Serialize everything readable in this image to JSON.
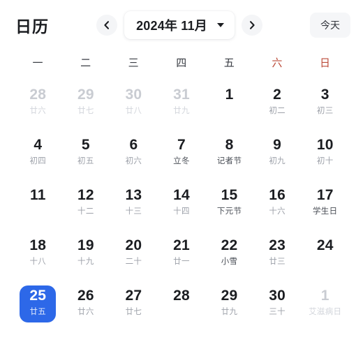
{
  "header": {
    "app_title": "日历",
    "prev_icon": "chevron-left-icon",
    "next_icon": "chevron-right-icon",
    "month_label": "2024年 11月",
    "dropdown_icon": "caret-down-icon",
    "today_label": "今天"
  },
  "colors": {
    "accent": "#2d68e8",
    "weekend": "#bb4a38",
    "text": "#1b1d21",
    "muted": "#9ea2aa",
    "outside": "#c9ccd2",
    "chip_bg": "#f4f5f7"
  },
  "weekdays": [
    {
      "label": "一",
      "weekend": false
    },
    {
      "label": "二",
      "weekend": false
    },
    {
      "label": "三",
      "weekend": false
    },
    {
      "label": "四",
      "weekend": false
    },
    {
      "label": "五",
      "weekend": false
    },
    {
      "label": "六",
      "weekend": true
    },
    {
      "label": "日",
      "weekend": true
    }
  ],
  "days": [
    {
      "day": "28",
      "lunar": "廿六",
      "outside": true,
      "festival": false,
      "selected": false
    },
    {
      "day": "29",
      "lunar": "廿七",
      "outside": true,
      "festival": false,
      "selected": false
    },
    {
      "day": "30",
      "lunar": "廿八",
      "outside": true,
      "festival": false,
      "selected": false
    },
    {
      "day": "31",
      "lunar": "廿九",
      "outside": true,
      "festival": false,
      "selected": false
    },
    {
      "day": "1",
      "lunar": "",
      "outside": false,
      "festival": false,
      "selected": false
    },
    {
      "day": "2",
      "lunar": "初二",
      "outside": false,
      "festival": false,
      "selected": false
    },
    {
      "day": "3",
      "lunar": "初三",
      "outside": false,
      "festival": false,
      "selected": false
    },
    {
      "day": "4",
      "lunar": "初四",
      "outside": false,
      "festival": false,
      "selected": false
    },
    {
      "day": "5",
      "lunar": "初五",
      "outside": false,
      "festival": false,
      "selected": false
    },
    {
      "day": "6",
      "lunar": "初六",
      "outside": false,
      "festival": false,
      "selected": false
    },
    {
      "day": "7",
      "lunar": "立冬",
      "outside": false,
      "festival": true,
      "selected": false
    },
    {
      "day": "8",
      "lunar": "记者节",
      "outside": false,
      "festival": true,
      "selected": false
    },
    {
      "day": "9",
      "lunar": "初九",
      "outside": false,
      "festival": false,
      "selected": false
    },
    {
      "day": "10",
      "lunar": "初十",
      "outside": false,
      "festival": false,
      "selected": false
    },
    {
      "day": "11",
      "lunar": "",
      "outside": false,
      "festival": false,
      "selected": false
    },
    {
      "day": "12",
      "lunar": "十二",
      "outside": false,
      "festival": false,
      "selected": false
    },
    {
      "day": "13",
      "lunar": "十三",
      "outside": false,
      "festival": false,
      "selected": false
    },
    {
      "day": "14",
      "lunar": "十四",
      "outside": false,
      "festival": false,
      "selected": false
    },
    {
      "day": "15",
      "lunar": "下元节",
      "outside": false,
      "festival": true,
      "selected": false
    },
    {
      "day": "16",
      "lunar": "十六",
      "outside": false,
      "festival": false,
      "selected": false
    },
    {
      "day": "17",
      "lunar": "学生日",
      "outside": false,
      "festival": true,
      "selected": false
    },
    {
      "day": "18",
      "lunar": "十八",
      "outside": false,
      "festival": false,
      "selected": false
    },
    {
      "day": "19",
      "lunar": "十九",
      "outside": false,
      "festival": false,
      "selected": false
    },
    {
      "day": "20",
      "lunar": "二十",
      "outside": false,
      "festival": false,
      "selected": false
    },
    {
      "day": "21",
      "lunar": "廿一",
      "outside": false,
      "festival": false,
      "selected": false
    },
    {
      "day": "22",
      "lunar": "小雪",
      "outside": false,
      "festival": true,
      "selected": false
    },
    {
      "day": "23",
      "lunar": "廿三",
      "outside": false,
      "festival": false,
      "selected": false
    },
    {
      "day": "24",
      "lunar": "",
      "outside": false,
      "festival": false,
      "selected": false
    },
    {
      "day": "25",
      "lunar": "廿五",
      "outside": false,
      "festival": false,
      "selected": true
    },
    {
      "day": "26",
      "lunar": "廿六",
      "outside": false,
      "festival": false,
      "selected": false
    },
    {
      "day": "27",
      "lunar": "廿七",
      "outside": false,
      "festival": false,
      "selected": false
    },
    {
      "day": "28",
      "lunar": "",
      "outside": false,
      "festival": false,
      "selected": false
    },
    {
      "day": "29",
      "lunar": "廿九",
      "outside": false,
      "festival": false,
      "selected": false
    },
    {
      "day": "30",
      "lunar": "三十",
      "outside": false,
      "festival": false,
      "selected": false
    },
    {
      "day": "1",
      "lunar": "艾滋病日",
      "outside": true,
      "festival": false,
      "selected": false
    }
  ]
}
